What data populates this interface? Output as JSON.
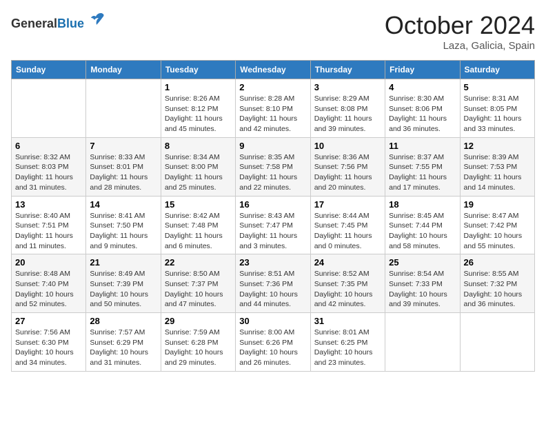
{
  "header": {
    "logo_general": "General",
    "logo_blue": "Blue",
    "month_title": "October 2024",
    "location": "Laza, Galicia, Spain"
  },
  "days_of_week": [
    "Sunday",
    "Monday",
    "Tuesday",
    "Wednesday",
    "Thursday",
    "Friday",
    "Saturday"
  ],
  "weeks": [
    [
      {
        "day": "",
        "info": ""
      },
      {
        "day": "",
        "info": ""
      },
      {
        "day": "1",
        "info": "Sunrise: 8:26 AM\nSunset: 8:12 PM\nDaylight: 11 hours and 45 minutes."
      },
      {
        "day": "2",
        "info": "Sunrise: 8:28 AM\nSunset: 8:10 PM\nDaylight: 11 hours and 42 minutes."
      },
      {
        "day": "3",
        "info": "Sunrise: 8:29 AM\nSunset: 8:08 PM\nDaylight: 11 hours and 39 minutes."
      },
      {
        "day": "4",
        "info": "Sunrise: 8:30 AM\nSunset: 8:06 PM\nDaylight: 11 hours and 36 minutes."
      },
      {
        "day": "5",
        "info": "Sunrise: 8:31 AM\nSunset: 8:05 PM\nDaylight: 11 hours and 33 minutes."
      }
    ],
    [
      {
        "day": "6",
        "info": "Sunrise: 8:32 AM\nSunset: 8:03 PM\nDaylight: 11 hours and 31 minutes."
      },
      {
        "day": "7",
        "info": "Sunrise: 8:33 AM\nSunset: 8:01 PM\nDaylight: 11 hours and 28 minutes."
      },
      {
        "day": "8",
        "info": "Sunrise: 8:34 AM\nSunset: 8:00 PM\nDaylight: 11 hours and 25 minutes."
      },
      {
        "day": "9",
        "info": "Sunrise: 8:35 AM\nSunset: 7:58 PM\nDaylight: 11 hours and 22 minutes."
      },
      {
        "day": "10",
        "info": "Sunrise: 8:36 AM\nSunset: 7:56 PM\nDaylight: 11 hours and 20 minutes."
      },
      {
        "day": "11",
        "info": "Sunrise: 8:37 AM\nSunset: 7:55 PM\nDaylight: 11 hours and 17 minutes."
      },
      {
        "day": "12",
        "info": "Sunrise: 8:39 AM\nSunset: 7:53 PM\nDaylight: 11 hours and 14 minutes."
      }
    ],
    [
      {
        "day": "13",
        "info": "Sunrise: 8:40 AM\nSunset: 7:51 PM\nDaylight: 11 hours and 11 minutes."
      },
      {
        "day": "14",
        "info": "Sunrise: 8:41 AM\nSunset: 7:50 PM\nDaylight: 11 hours and 9 minutes."
      },
      {
        "day": "15",
        "info": "Sunrise: 8:42 AM\nSunset: 7:48 PM\nDaylight: 11 hours and 6 minutes."
      },
      {
        "day": "16",
        "info": "Sunrise: 8:43 AM\nSunset: 7:47 PM\nDaylight: 11 hours and 3 minutes."
      },
      {
        "day": "17",
        "info": "Sunrise: 8:44 AM\nSunset: 7:45 PM\nDaylight: 11 hours and 0 minutes."
      },
      {
        "day": "18",
        "info": "Sunrise: 8:45 AM\nSunset: 7:44 PM\nDaylight: 10 hours and 58 minutes."
      },
      {
        "day": "19",
        "info": "Sunrise: 8:47 AM\nSunset: 7:42 PM\nDaylight: 10 hours and 55 minutes."
      }
    ],
    [
      {
        "day": "20",
        "info": "Sunrise: 8:48 AM\nSunset: 7:40 PM\nDaylight: 10 hours and 52 minutes."
      },
      {
        "day": "21",
        "info": "Sunrise: 8:49 AM\nSunset: 7:39 PM\nDaylight: 10 hours and 50 minutes."
      },
      {
        "day": "22",
        "info": "Sunrise: 8:50 AM\nSunset: 7:37 PM\nDaylight: 10 hours and 47 minutes."
      },
      {
        "day": "23",
        "info": "Sunrise: 8:51 AM\nSunset: 7:36 PM\nDaylight: 10 hours and 44 minutes."
      },
      {
        "day": "24",
        "info": "Sunrise: 8:52 AM\nSunset: 7:35 PM\nDaylight: 10 hours and 42 minutes."
      },
      {
        "day": "25",
        "info": "Sunrise: 8:54 AM\nSunset: 7:33 PM\nDaylight: 10 hours and 39 minutes."
      },
      {
        "day": "26",
        "info": "Sunrise: 8:55 AM\nSunset: 7:32 PM\nDaylight: 10 hours and 36 minutes."
      }
    ],
    [
      {
        "day": "27",
        "info": "Sunrise: 7:56 AM\nSunset: 6:30 PM\nDaylight: 10 hours and 34 minutes."
      },
      {
        "day": "28",
        "info": "Sunrise: 7:57 AM\nSunset: 6:29 PM\nDaylight: 10 hours and 31 minutes."
      },
      {
        "day": "29",
        "info": "Sunrise: 7:59 AM\nSunset: 6:28 PM\nDaylight: 10 hours and 29 minutes."
      },
      {
        "day": "30",
        "info": "Sunrise: 8:00 AM\nSunset: 6:26 PM\nDaylight: 10 hours and 26 minutes."
      },
      {
        "day": "31",
        "info": "Sunrise: 8:01 AM\nSunset: 6:25 PM\nDaylight: 10 hours and 23 minutes."
      },
      {
        "day": "",
        "info": ""
      },
      {
        "day": "",
        "info": ""
      }
    ]
  ]
}
